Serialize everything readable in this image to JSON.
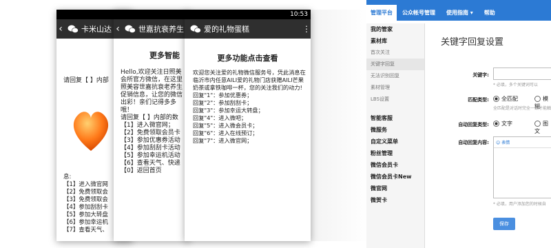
{
  "phone1": {
    "time": "",
    "title": "卡米山达",
    "body": "请回复【 】内部",
    "menu": "息:\n【1】进入微官网\n【2】免费领取会\n【3】免费领取会\n【4】参加刮刮卡\n【5】参加大转盘\n【6】参加幸运机\n【7】查看天气、"
  },
  "phone2": {
    "title": "世嘉抗衰养生",
    "header": "更多智能",
    "body": "Hello,欢迎关注日照美\n会所官方微信，在这里\n照美容世嘉抗衰老养生\n促销信息，让您的微信\n出彩！亲们记得多多\n哦！\n请回复【 】内部的数\n【1】进入微官网；\n【2】免费领取会员卡\n【3】参加优惠券活动\n【4】参加刮刮卡活动\n【5】参加幸运机活动\n【6】查看天气、快递\n【0】返回首页"
  },
  "phone3": {
    "time": "10:53",
    "title": "爱的礼物蛋糕",
    "header": "更多功能点击查看",
    "body": "欢迎您关注爱的礼物微信服务号，凭此消息在\n临沂市内任意AILI爱的礼物门店获赠AILI芒果\n奶茶或拿铁咖啡一杯，您的关注我们的动力!\n回复\"1\"：参加优惠券；\n回复\"2\"：参加刮刮卡；\n回复\"3\"：参加幸运大转盘；\n回复\"4\"：进入微吧；\n回复\"5\"：进入微会员卡；\n回复\"6\"：进入在线预订；\n回复\"7\"：进入微官网；"
  },
  "admin": {
    "nav": [
      "管理平台",
      "公众帐号管理",
      "使用指南 ▾",
      "帮助"
    ],
    "sidebar": [
      {
        "label": "我的管家",
        "kind": "head"
      },
      {
        "label": "素材库",
        "kind": "head"
      },
      {
        "label": "首次关注",
        "kind": "sub"
      },
      {
        "label": "关键字回复",
        "kind": "sub-active"
      },
      {
        "label": "无法识别回复",
        "kind": "sub"
      },
      {
        "label": "素材管理",
        "kind": "sub"
      },
      {
        "label": "LBS设置",
        "kind": "sub"
      },
      {
        "label": "",
        "kind": "gap"
      },
      {
        "label": "智能客服",
        "kind": "head"
      },
      {
        "label": "微服务",
        "kind": "head"
      },
      {
        "label": "自定义菜单",
        "kind": "head"
      },
      {
        "label": "粉丝管理",
        "kind": "head"
      },
      {
        "label": "微信会员卡",
        "kind": "head"
      },
      {
        "label": "微信会员卡New",
        "kind": "head"
      },
      {
        "label": "微官网",
        "kind": "head"
      },
      {
        "label": "微贺卡",
        "kind": "head"
      }
    ],
    "page_title": "关键字回复设置",
    "keyword_label": "关键字:",
    "keyword_hint": "必填，多个关键词可以",
    "match_label": "匹配类型:",
    "match_options": [
      "全匹配",
      "模糊"
    ],
    "match_hint": "全匹配是对话时完全一致才能触发",
    "reply_type_label": "自动回复类型:",
    "reply_type_options": [
      "文字",
      "图文"
    ],
    "reply_content_label": "自动回复内容:",
    "emoji_label": "表情",
    "content_hint": "必填，用户添加您的时候自",
    "save_label": "保存"
  }
}
